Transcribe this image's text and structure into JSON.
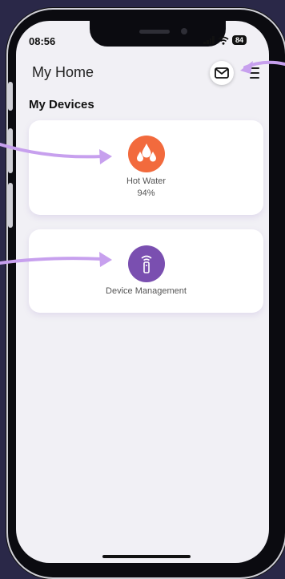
{
  "status": {
    "time": "08:56",
    "battery": "84"
  },
  "header": {
    "title": "My Home",
    "mail_icon": "envelope-icon",
    "menu_icon": "hamburger-menu-icon"
  },
  "section": {
    "title": "My Devices"
  },
  "devices": [
    {
      "label": "Hot Water",
      "value": "94%",
      "icon": "water-drops-icon",
      "color": "#f26a3d"
    },
    {
      "label": "Device Management",
      "icon": "remote-control-icon",
      "color": "#7a4fb0"
    }
  ],
  "colors": {
    "arrow": "#c7a0ee",
    "background": "#2a2848",
    "screen": "#f1f0f5"
  }
}
